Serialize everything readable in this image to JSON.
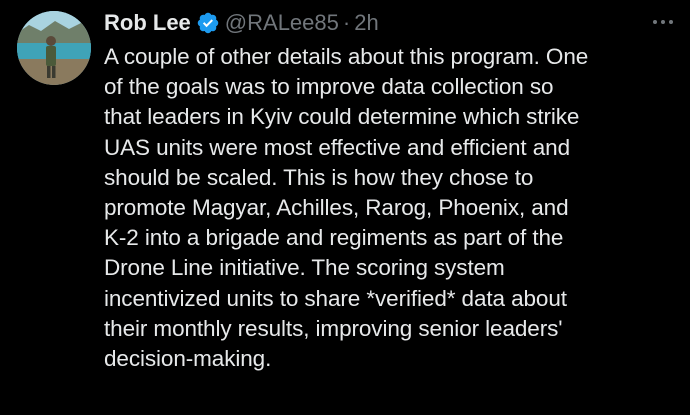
{
  "post": {
    "author_name": "Rob Lee",
    "handle": "@RALee85",
    "separator": "·",
    "time": "2h",
    "body_lines": [
      "A couple of other details about this program. One",
      "of the goals was to improve data collection so",
      "that leaders in Kyiv could determine which strike",
      "UAS units were most effective and efficient and",
      "should be scaled. This is how they chose to",
      "promote Magyar, Achilles, Rarog, Phoenix, and",
      "K-2 into a brigade and regiments as part of the",
      "Drone Line initiative. The scoring system",
      "incentivized units to share *verified* data about",
      "their monthly results, improving senior leaders'",
      "decision-making."
    ]
  },
  "icons": {
    "verified": "verified-badge-icon",
    "more": "more-options-icon"
  },
  "colors": {
    "background": "#000000",
    "text": "#e7e9ea",
    "muted": "#71767b",
    "verified": "#1d9bf0"
  }
}
